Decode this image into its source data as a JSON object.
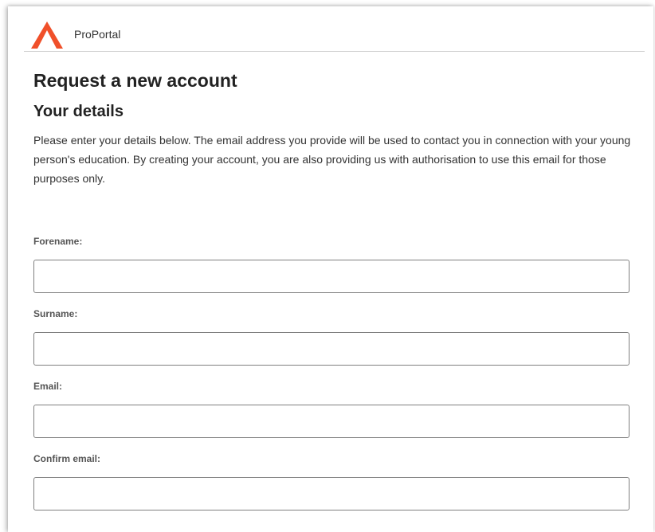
{
  "header": {
    "brand": "ProPortal",
    "logo_color": "#f0502a",
    "logo_icon": "orange-chevron-logo"
  },
  "page": {
    "title": "Request a new account",
    "subtitle": "Your details",
    "intro": "Please enter your details below. The email address you provide will be used to contact you in connection with your young person's education. By creating your account, you are also providing us with authorisation to use this email for those purposes only."
  },
  "form": {
    "forename": {
      "label": "Forename:",
      "value": ""
    },
    "surname": {
      "label": "Surname:",
      "value": ""
    },
    "email": {
      "label": "Email:",
      "value": ""
    },
    "confirm_email": {
      "label": "Confirm email:",
      "value": ""
    }
  }
}
